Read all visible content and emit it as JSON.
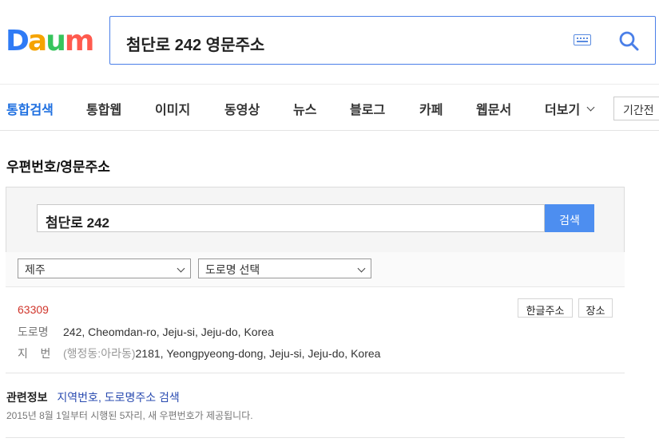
{
  "logo": {
    "letters": [
      "D",
      "a",
      "u",
      "m"
    ],
    "colors": [
      "#2f7bf5",
      "#f5a300",
      "#36c45c",
      "#ff5a4e"
    ]
  },
  "search": {
    "query": "첨단로 242 영문주소"
  },
  "tabs": [
    {
      "label": "통합검색",
      "active": true
    },
    {
      "label": "통합웹"
    },
    {
      "label": "이미지"
    },
    {
      "label": "동영상"
    },
    {
      "label": "뉴스"
    },
    {
      "label": "블로그"
    },
    {
      "label": "카페"
    },
    {
      "label": "웹문서"
    },
    {
      "label": "더보기"
    }
  ],
  "period_button": "기간전",
  "section_title": "우편번호/영문주소",
  "zip_search": {
    "query": "첨단로 242",
    "button": "검색"
  },
  "filters": {
    "region": "제주",
    "road": "도로명 선택"
  },
  "result": {
    "zipcode": "63309",
    "road_label": "도로명",
    "road_address": "242, Cheomdan-ro, Jeju-si, Jeju-do, Korea",
    "lot_label": "지    번",
    "lot_prefix": "(행정동:아라동)",
    "lot_address": "2181, Yeongpyeong-dong, Jeju-si, Jeju-do, Korea",
    "korean_button": "한글주소",
    "place_button": "장소"
  },
  "related": {
    "label": "관련정보",
    "link1": "지역번호",
    "separator": ", ",
    "link2": "도로명주소 검색",
    "note": "2015년 8월 1일부터 시행된 5자리, 새 우편번호가 제공됩니다."
  }
}
